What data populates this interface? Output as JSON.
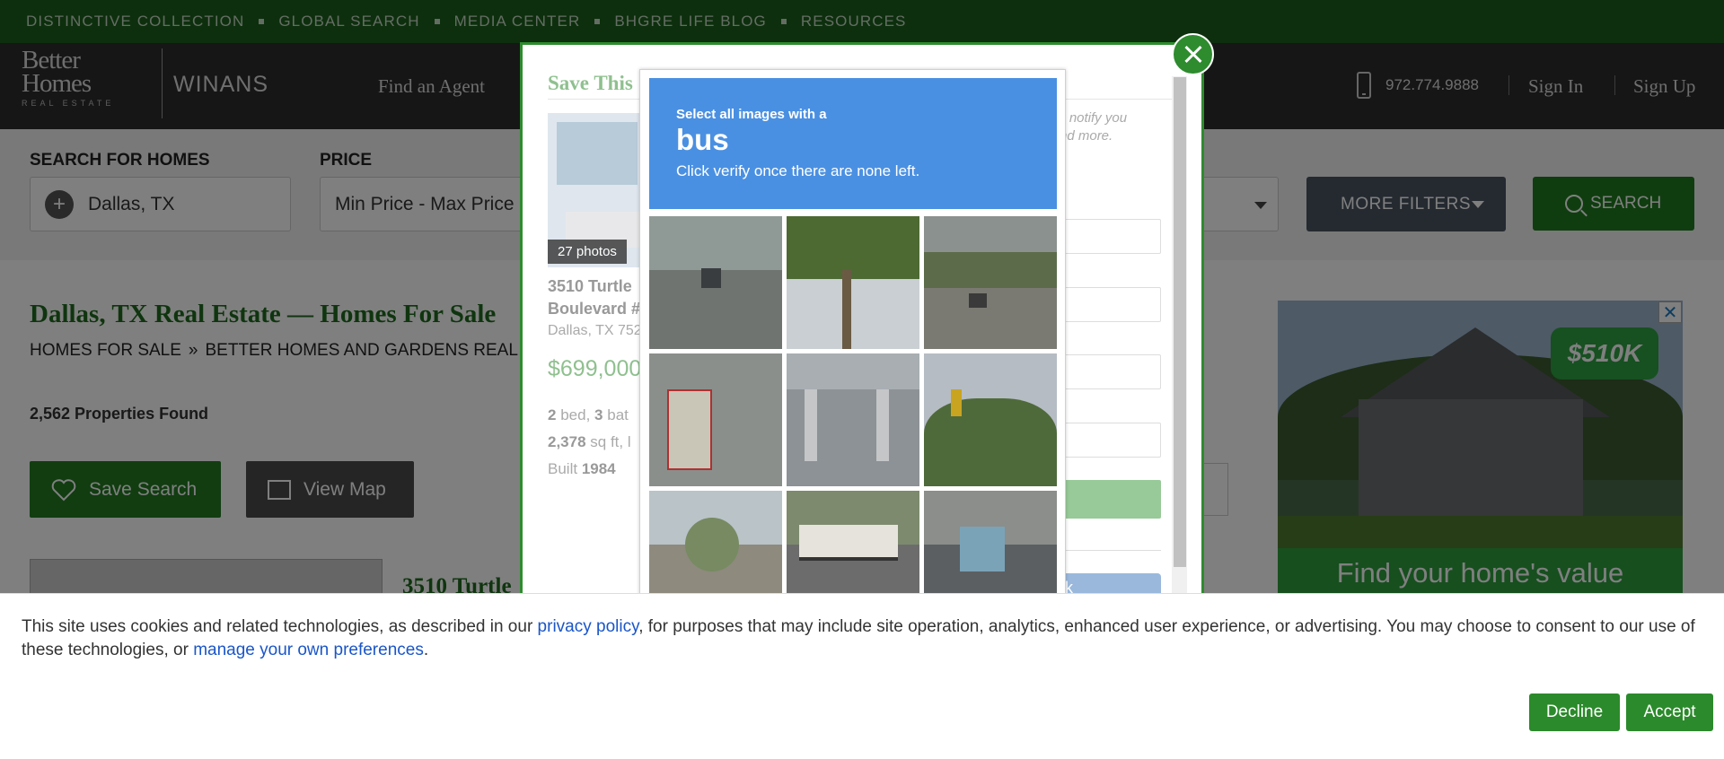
{
  "topbar": {
    "items": [
      "DISTINCTIVE COLLECTION",
      "GLOBAL SEARCH",
      "MEDIA CENTER",
      "BHGRE LIFE BLOG",
      "RESOURCES"
    ]
  },
  "header": {
    "logo_line1": "Better",
    "logo_line2": "Homes",
    "logo_line3": "REAL ESTATE",
    "brand": "WINANS",
    "nav_find_agent": "Find an Agent",
    "phone": "972.774.9888",
    "sign_in": "Sign In",
    "sign_up": "Sign Up"
  },
  "search": {
    "label_search": "SEARCH FOR HOMES",
    "location_value": "Dallas, TX",
    "label_price": "PRICE",
    "price_value": "Min Price  -  Max Price",
    "more_filters": "MORE FILTERS",
    "search_button": "SEARCH"
  },
  "main": {
    "title": "Dallas, TX Real Estate — Homes For Sale",
    "breadcrumb_1": "HOMES FOR SALE",
    "breadcrumb_sep": "»",
    "breadcrumb_2": "BETTER HOMES AND GARDENS REAL ESTATE",
    "properties_found": "2,562 Properties Found",
    "save_search": "Save Search",
    "view_map": "View Map",
    "card_title": "3510 Turtle"
  },
  "ad": {
    "price_bubble": "$510K",
    "value_text": "Find your home's value",
    "close": "✕"
  },
  "save_modal": {
    "title": "Save This",
    "photos": "27 photos",
    "address_line1": "3510 Turtle",
    "address_line2": "Boulevard #",
    "city": "Dallas, TX 752",
    "price": "$699,000",
    "beds_num": "2",
    "beds_label": "bed,",
    "baths_num": "3",
    "baths_label": "bat",
    "sqft_num": "2,378",
    "sqft_label": "sq ft, l",
    "built_label": "Built",
    "built_year": "1984",
    "notify_line1": "ll notify you",
    "notify_line2": "nd more.",
    "blue_btn_fragment": "k"
  },
  "captcha": {
    "line1": "Select all images with a",
    "line2": "bus",
    "line3": "Click verify once there are none left."
  },
  "cookie": {
    "text_before": "This site uses cookies and related technologies, as described in our ",
    "privacy_link": "privacy policy",
    "text_middle": ", for purposes that may include site operation, analytics, enhanced user experience, or advertising. You may choose to consent to our use of these technologies, or ",
    "prefs_link": "manage your own preferences",
    "text_after": ".",
    "decline": "Decline",
    "accept": "Accept"
  },
  "colors": {
    "brand_green": "#1a5f1a",
    "button_green": "#237a23",
    "captcha_blue": "#4a90e2",
    "link_blue": "#1a56c8"
  }
}
